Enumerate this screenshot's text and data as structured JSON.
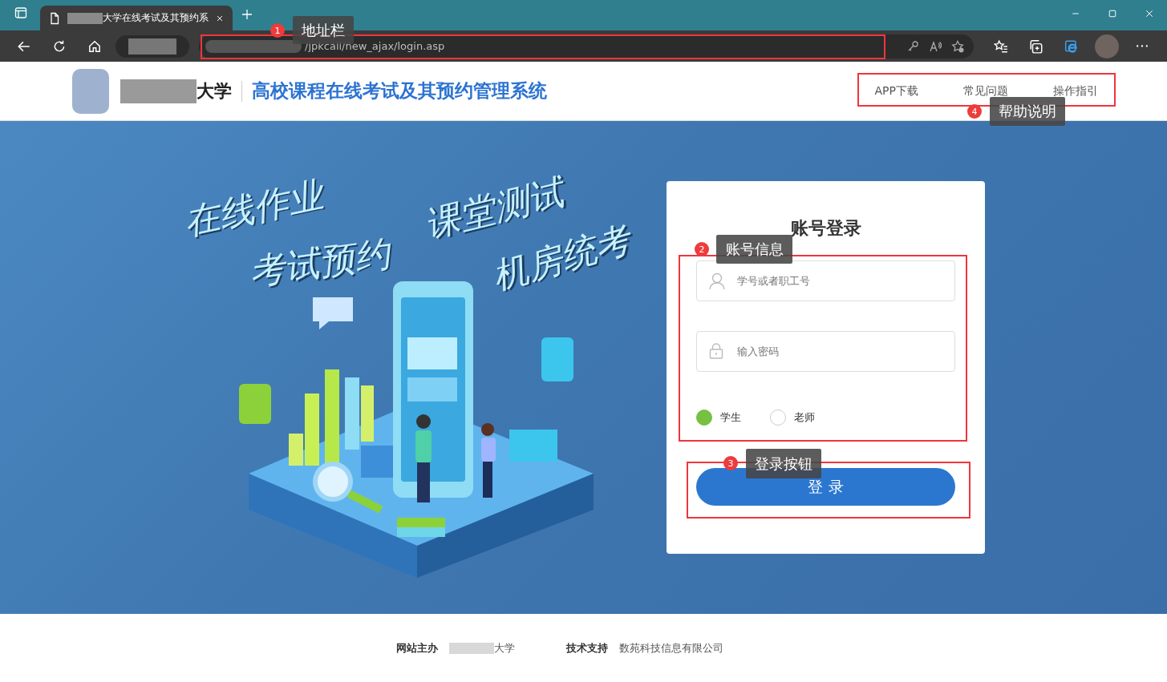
{
  "browser": {
    "tab_title": "大学在线考试及其预约系",
    "address": "/jpkcall/new_ajax/login.asp"
  },
  "header": {
    "university_suffix": "大学",
    "system_title": "高校课程在线考试及其预约管理系统",
    "nav_links": [
      "APP下载",
      "常见问题",
      "操作指引"
    ]
  },
  "banner": {
    "slogans": [
      "在线作业",
      "考试预约",
      "课堂测试",
      "机房统考"
    ]
  },
  "login": {
    "title": "账号登录",
    "fields": [
      {
        "kind": "user",
        "placeholder": "学号或者职工号"
      },
      {
        "kind": "password",
        "placeholder": "输入密码"
      }
    ],
    "roles": [
      {
        "label": "学生",
        "selected": true
      },
      {
        "label": "老师",
        "selected": false
      }
    ],
    "submit": "登 录"
  },
  "footer": {
    "host_label": "网站主办",
    "host_suffix": "大学",
    "support_label": "技术支持",
    "support_value": "数苑科技信息有限公司"
  },
  "annotations": [
    {
      "number": "1",
      "label": "地址栏"
    },
    {
      "number": "2",
      "label": "账号信息"
    },
    {
      "number": "3",
      "label": "登录按钮"
    },
    {
      "number": "4",
      "label": "帮助说明"
    }
  ]
}
